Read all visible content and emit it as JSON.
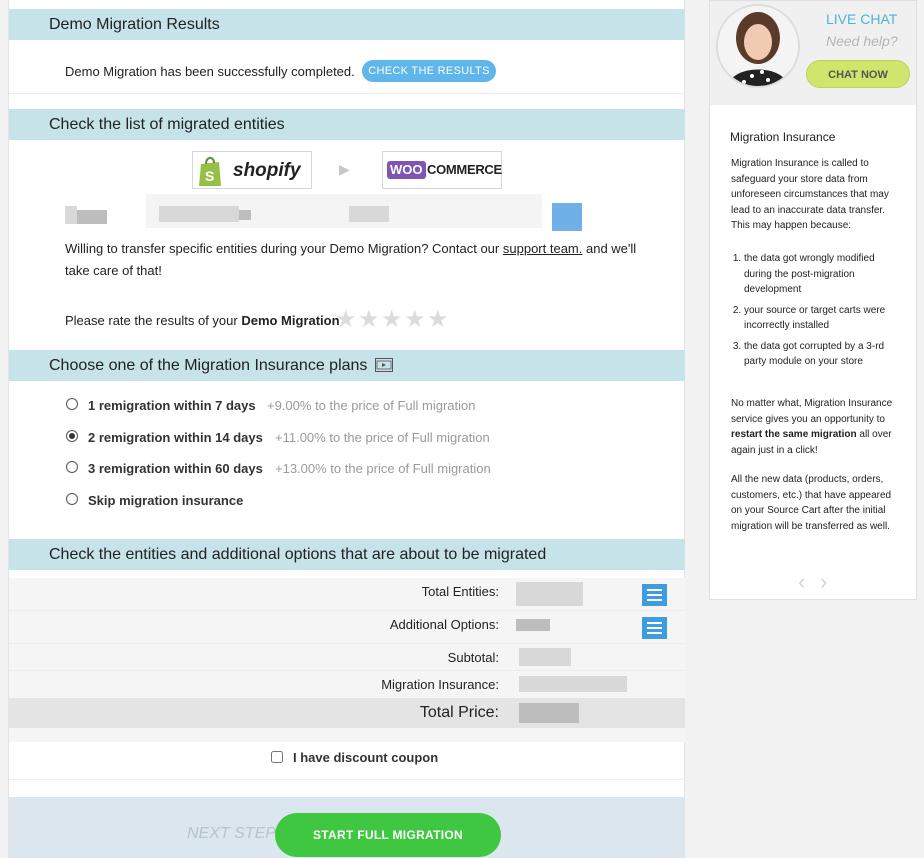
{
  "demo": {
    "title": "Demo Migration Results",
    "message": "Demo Migration has been successfully completed.",
    "check_button": "CHECK THE RESULTS"
  },
  "entities": {
    "title": "Check the list of migrated entities",
    "source_logo": "shopify",
    "target_logo_woo": "WOO",
    "target_logo_commerce": "COMMERCE",
    "arrow": "▶",
    "willing_text_1": "Willing to transfer specific entities during your Demo Migration? Contact our",
    "support_link": "support team.",
    "willing_text_2": " and we'll",
    "willing_text_3": "take care of that!",
    "rate_text": "Please rate the results of your",
    "rate_bold": "Demo Migration",
    "stars": [
      "★",
      "★",
      "★",
      "★",
      "★"
    ]
  },
  "insurance": {
    "title": "Choose one of the Migration Insurance plans",
    "options": [
      {
        "label": "1 remigration within 7 days",
        "price": "+9.00% to the price of Full migration",
        "checked": false
      },
      {
        "label": "2 remigration within 14 days",
        "price": "+11.00% to the price of Full migration",
        "checked": true
      },
      {
        "label": "3 remigration within 60 days",
        "price": "+13.00% to the price of Full migration",
        "checked": false
      },
      {
        "label": "Skip migration insurance",
        "price": "",
        "checked": false
      }
    ]
  },
  "summary": {
    "title": "Check the entities and additional options that are about to be migrated",
    "total_entities": "Total Entities:",
    "additional_options": "Additional Options:",
    "subtotal": "Subtotal:",
    "migration_insurance": "Migration Insurance:",
    "total_price": "Total Price:",
    "coupon": "I have discount coupon"
  },
  "footer": {
    "next_step": "NEXT STEP",
    "start_button": "START FULL MIGRATION"
  },
  "sidebar": {
    "live_chat": "LIVE CHAT",
    "need_help": "Need help?",
    "chat_now": "CHAT NOW",
    "title": "Migration Insurance",
    "intro": "Migration Insurance is called to safeguard your store data from unforeseen circumstances that may lead to an inaccurate data transfer. This may happen because:",
    "list": [
      "the data got wrongly modified during the post-migration development",
      "your source or target carts were incorrectly installed",
      "the data got corrupted by a 3-rd party module on your store"
    ],
    "para2_a": "No matter what, Migration Insurance service gives you an opportunity to ",
    "para2_bold": "restart the same migration",
    "para2_b": " all over again just in a click!",
    "para3": "All the new data (products, orders, customers, etc.) that have appeared on your Source Cart after the initial migration will be transferred as well.",
    "prev": "‹",
    "next": "›"
  },
  "colors": {
    "section_header": "#c5e3e8",
    "check_button": "#5fb6ea",
    "start_button": "#3fc741",
    "chat_button": "#cfe56b",
    "live_chat_text": "#49b6d6"
  }
}
